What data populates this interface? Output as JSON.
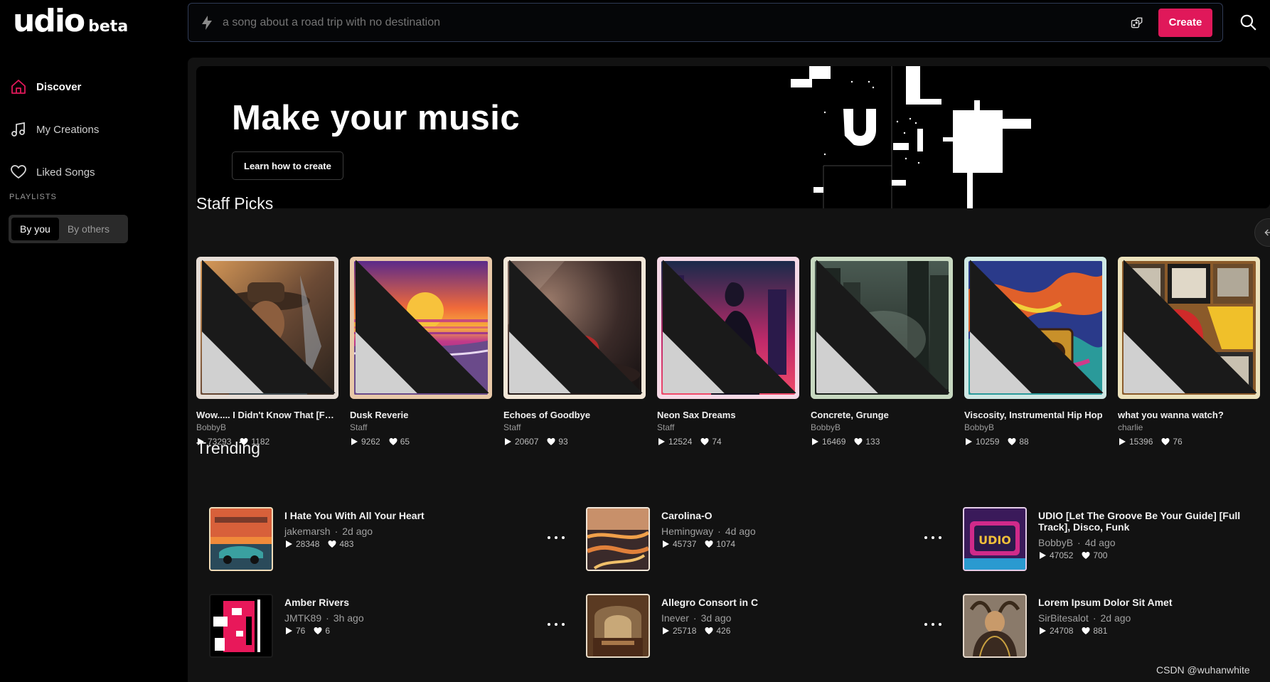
{
  "brand": {
    "word": "udio",
    "badge": "beta"
  },
  "sidebar": {
    "items": [
      {
        "label": "Discover",
        "icon": "home-icon",
        "active": true
      },
      {
        "label": "My Creations",
        "icon": "music-note-icon"
      },
      {
        "label": "Liked Songs",
        "icon": "heart-icon"
      }
    ],
    "playlists_label": "PLAYLISTS",
    "playlist_tabs": [
      {
        "label": "By you",
        "active": true
      },
      {
        "label": "By others"
      }
    ]
  },
  "prompt": {
    "placeholder": "a song about a road trip with no destination",
    "create_label": "Create"
  },
  "hero": {
    "title": "Make your music",
    "button_label": "Learn how to create"
  },
  "staff_picks": {
    "title": "Staff Picks",
    "items": [
      {
        "title": "Wow..... I Didn't Know That [Full...",
        "artist": "BobbyB",
        "plays": "73293",
        "likes": "1182",
        "frame": "#e6ddd6"
      },
      {
        "title": "Dusk Reverie",
        "artist": "Staff",
        "plays": "9262",
        "likes": "65",
        "frame": "#e8c8a8"
      },
      {
        "title": "Echoes of Goodbye",
        "artist": "Staff",
        "plays": "20607",
        "likes": "93",
        "frame": "#f3e7d8"
      },
      {
        "title": "Neon Sax Dreams",
        "artist": "Staff",
        "plays": "12524",
        "likes": "74",
        "frame": "#f6d9e6"
      },
      {
        "title": "Concrete, Grunge",
        "artist": "BobbyB",
        "plays": "16469",
        "likes": "133",
        "frame": "#c7d8c0"
      },
      {
        "title": "Viscosity, Instrumental Hip Hop",
        "artist": "BobbyB",
        "plays": "10259",
        "likes": "88",
        "frame": "#cfe8e4"
      },
      {
        "title": "what you wanna watch?",
        "artist": "charlie",
        "plays": "15396",
        "likes": "76",
        "frame": "#ece2bc"
      }
    ]
  },
  "trending": {
    "title": "Trending",
    "items": [
      {
        "title": "I Hate You With All Your Heart",
        "artist": "jakemarsh",
        "age": "2d ago",
        "plays": "28348",
        "likes": "483",
        "frame": "#f0dcb8"
      },
      {
        "title": "Carolina-O",
        "artist": "Hemingway",
        "age": "4d ago",
        "plays": "45737",
        "likes": "1074",
        "frame": "#f2e6d8"
      },
      {
        "title": "UDIO [Let The Groove Be Your Guide] [Full Track], Disco, Funk",
        "artist": "BobbyB",
        "age": "4d ago",
        "plays": "47052",
        "likes": "700",
        "frame": "#e4cde8"
      },
      {
        "title": "Amber Rivers",
        "artist": "JMTK89",
        "age": "3h ago",
        "plays": "76",
        "likes": "6",
        "frame": "#1c1c1c"
      },
      {
        "title": "Allegro Consort in C",
        "artist": "Inever",
        "age": "3d ago",
        "plays": "25718",
        "likes": "426",
        "frame": "#e8dcc8"
      },
      {
        "title": "Lorem Ipsum Dolor Sit Amet",
        "artist": "SirBitesalot",
        "age": "2d ago",
        "plays": "24708",
        "likes": "881",
        "frame": "#e6d9cc"
      }
    ]
  },
  "watermark": "CSDN @wuhanwhite",
  "colors": {
    "accent": "#e0185a",
    "panel": "#121212",
    "background": "#000000"
  }
}
